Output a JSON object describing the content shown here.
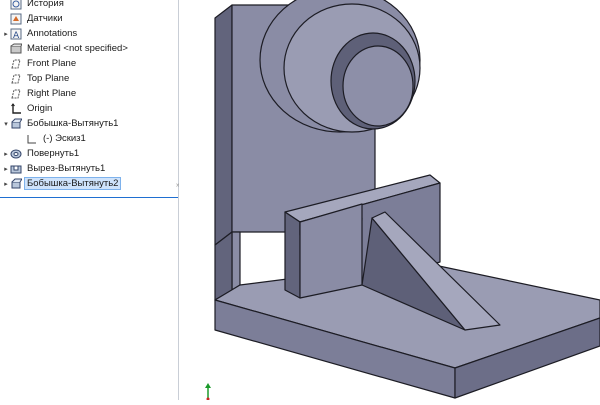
{
  "feature_tree": {
    "items": [
      {
        "label": "История",
        "icon": "history-icon",
        "expandable": false
      },
      {
        "label": "Датчики",
        "icon": "sensors-icon",
        "expandable": false
      },
      {
        "label": "Annotations",
        "icon": "annotations-icon",
        "expandable": true
      },
      {
        "label": "Material <not specified>",
        "icon": "material-icon",
        "expandable": false
      },
      {
        "label": "Front Plane",
        "icon": "plane-icon",
        "expandable": false
      },
      {
        "label": "Top Plane",
        "icon": "plane-icon",
        "expandable": false
      },
      {
        "label": "Right Plane",
        "icon": "plane-icon",
        "expandable": false
      },
      {
        "label": "Origin",
        "icon": "origin-icon",
        "expandable": false
      },
      {
        "label": "Бобышка-Вытянуть1",
        "icon": "boss-extrude-icon",
        "expandable": true,
        "expanded": true
      },
      {
        "label": "(-) Эскиз1",
        "icon": "sketch-icon",
        "expandable": false,
        "child": true
      },
      {
        "label": "Повернуть1",
        "icon": "revolve-icon",
        "expandable": true
      },
      {
        "label": "Вырез-Вытянуть1",
        "icon": "cut-extrude-icon",
        "expandable": true
      },
      {
        "label": "Бобышка-Вытянуть2",
        "icon": "boss-extrude-icon",
        "expandable": true,
        "selected": true
      }
    ]
  },
  "colors": {
    "selection": "#cfe3fb",
    "model_light": "#9a9cb3",
    "model_mid": "#7c7e98",
    "model_dark": "#5e6078",
    "edge": "#1c1c24"
  },
  "viewport": {
    "model_name": "bracket-part"
  }
}
